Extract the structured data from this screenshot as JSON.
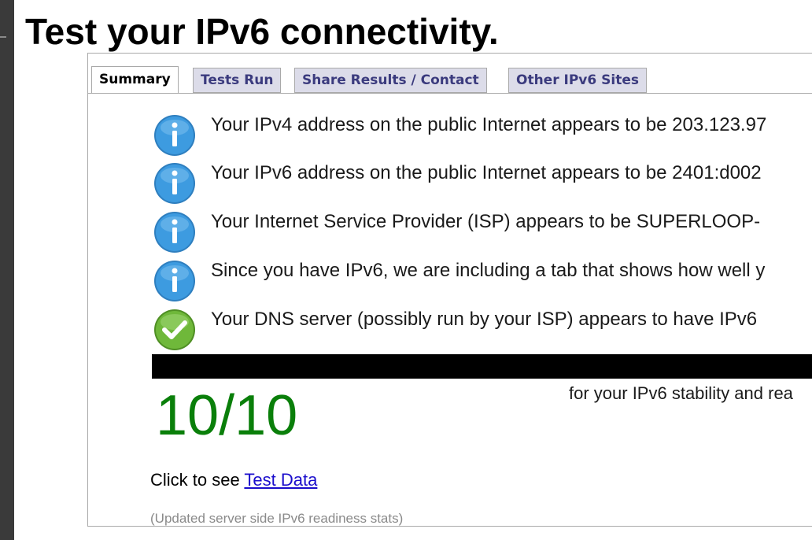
{
  "page": {
    "title": "Test your IPv6 connectivity."
  },
  "tabs": [
    {
      "label": "Summary",
      "active": true
    },
    {
      "label": "Tests Run",
      "active": false
    },
    {
      "label": "Share Results / Contact",
      "active": false
    },
    {
      "label": "Other IPv6 Sites",
      "active": false
    }
  ],
  "messages": [
    {
      "icon": "info-icon",
      "text": "Your IPv4 address on the public Internet appears to be 203.123.97"
    },
    {
      "icon": "info-icon",
      "text": "Your IPv6 address on the public Internet appears to be 2401:d002"
    },
    {
      "icon": "info-icon",
      "text": "Your Internet Service Provider (ISP) appears to be SUPERLOOP-"
    },
    {
      "icon": "info-icon",
      "text": "Since you have IPv6, we are including a tab that shows how well y"
    },
    {
      "icon": "check-icon",
      "text": "Your DNS server (possibly run by your ISP) appears to have IPv6"
    }
  ],
  "score": {
    "value": "10/10",
    "caption": "for your IPv6 stability and rea"
  },
  "test_data": {
    "prefix": "Click to see ",
    "link_label": "Test Data"
  },
  "footer": {
    "note": "(Updated server side IPv6 readiness stats)"
  },
  "colors": {
    "info_blue": "#3d9be0",
    "check_green": "#6fb83a",
    "score_green": "#0a7f0a",
    "tab_inactive_bg": "#dcdce9",
    "tab_inactive_text": "#3b3b7e",
    "link": "#1a0dcc"
  }
}
